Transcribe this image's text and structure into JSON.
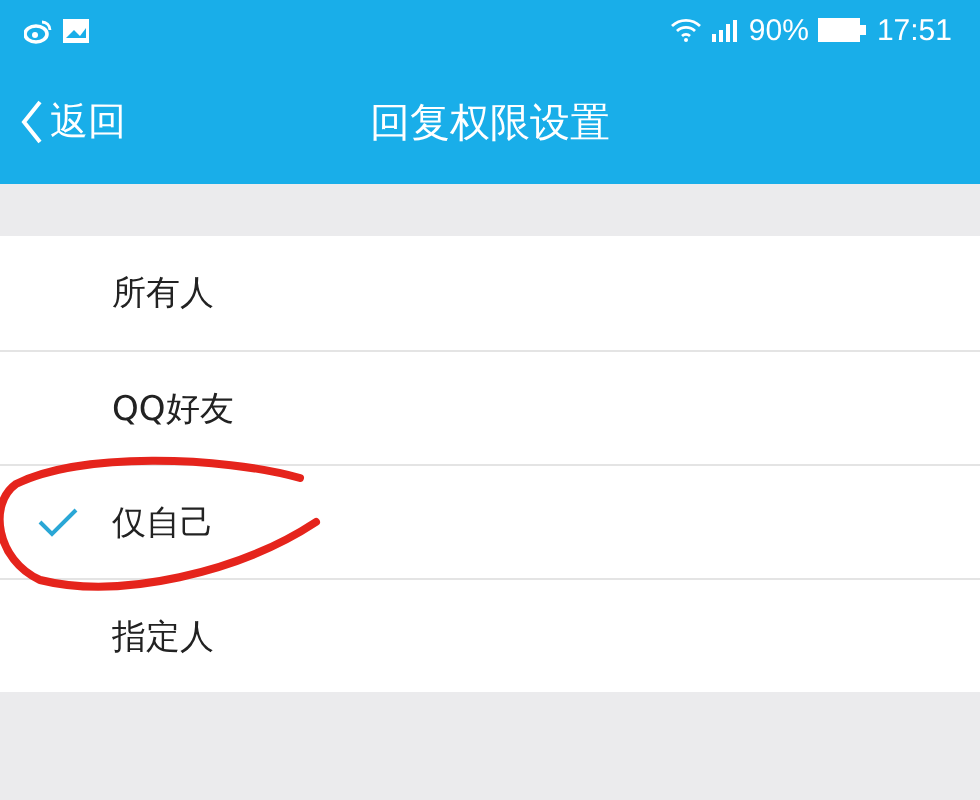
{
  "status_bar": {
    "battery_text": "90%",
    "time": "17:51"
  },
  "nav": {
    "back": "返回",
    "title": "回复权限设置"
  },
  "options": [
    {
      "label": "所有人",
      "selected": false
    },
    {
      "label": "QQ好友",
      "selected": false
    },
    {
      "label": "仅自己",
      "selected": true
    },
    {
      "label": "指定人",
      "selected": false
    }
  ],
  "annotation": {
    "kind": "circle",
    "color": "#e5241c"
  }
}
